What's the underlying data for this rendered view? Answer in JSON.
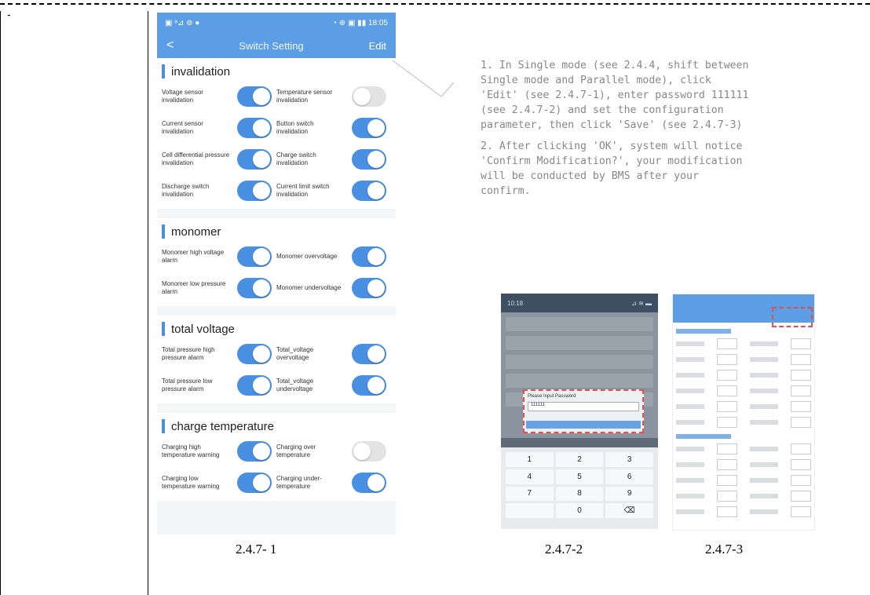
{
  "row_marker": "-",
  "phone1": {
    "status_left": "▣ ᵊ​⊿ ⊚ ●",
    "status_right": "◔ ⊕ ▣ ▮▮ 18:05",
    "nav": {
      "back": "<",
      "title": "Switch Setting",
      "edit": "Edit"
    },
    "sections": [
      {
        "title": "invalidation",
        "items": [
          {
            "label": "Voltage sensor invalidation",
            "state": "on"
          },
          {
            "label": "Temperature sensor invalidation",
            "state": "off"
          },
          {
            "label": "Current sensor invalidation",
            "state": "on"
          },
          {
            "label": "Button switch invalidation",
            "state": "on"
          },
          {
            "label": "Cell differential pressure invalidation",
            "state": "on"
          },
          {
            "label": "Charge switch invalidation",
            "state": "on"
          },
          {
            "label": "Discharge switch invalidation",
            "state": "on"
          },
          {
            "label": "Current limit switch invalidation",
            "state": "on"
          }
        ]
      },
      {
        "title": "monomer",
        "items": [
          {
            "label": "Monomer high voltage alarm",
            "state": "on"
          },
          {
            "label": "Monomer overvoltage",
            "state": "on"
          },
          {
            "label": "Monomer low pressure alarm",
            "state": "on"
          },
          {
            "label": "Monomer undervoltage",
            "state": "on"
          }
        ]
      },
      {
        "title": "total voltage",
        "items": [
          {
            "label": "Total pressure high pressure alarm",
            "state": "on"
          },
          {
            "label": "Total_voltage overvoltage",
            "state": "on"
          },
          {
            "label": "Total pressure low pressure alarm",
            "state": "on"
          },
          {
            "label": "Total_voltage undervoltage",
            "state": "on"
          }
        ]
      },
      {
        "title": "charge temperature",
        "items": [
          {
            "label": "Charging high temperature warning",
            "state": "on"
          },
          {
            "label": "Charging over temperature",
            "state": "off"
          },
          {
            "label": "Charging low temperature warning",
            "state": "on"
          },
          {
            "label": "Charging under-temperature",
            "state": "on"
          }
        ]
      }
    ]
  },
  "captions": {
    "fig1": "2.4.7- 1",
    "fig2": "2.4.7-2",
    "fig3": "2.4.7-3"
  },
  "notes": [
    "1. In Single mode (see 2.4.4, shift between\nSingle mode and Parallel mode), click\n'Edit' (see 2.4.7-1), enter password 111111\n(see 2.4.7-2) and set the configuration\nparameter, then click 'Save' (see 2.4.7-3)",
    "2. After clicking 'OK', system will notice\n'Confirm Modification?', your modification\nwill be conducted by BMS after your\nconfirm."
  ],
  "phone2": {
    "status_left": "10:18",
    "status_right": "⊿ ≋ ▬",
    "dialog_title": "Please Input Password",
    "dialog_value": "111111",
    "keys": [
      "1",
      "2",
      "3",
      "4",
      "5",
      "6",
      "7",
      "8",
      "9",
      "",
      "0",
      "⌫"
    ]
  },
  "colors": {
    "accent": "#4a90e2",
    "header": "#5b9ee6",
    "highlight": "#e05050"
  }
}
